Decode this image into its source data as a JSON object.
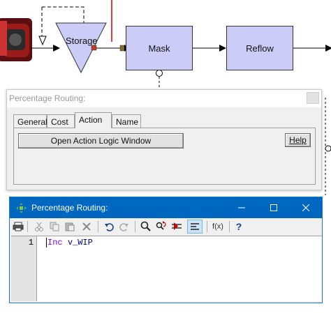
{
  "diagram": {
    "storage_label": "Storage",
    "mask_label": "Mask",
    "reflow_label": "Reflow",
    "colors": {
      "node_fill": "#ccccf8",
      "accent_red": "#d00000"
    }
  },
  "routing_dialog": {
    "title": "Percentage Routing:",
    "tabs": [
      {
        "label": "General"
      },
      {
        "label": "Cost"
      },
      {
        "label": "Action"
      },
      {
        "label": "Name"
      }
    ],
    "active_tab": "Action",
    "open_logic_button": "Open Action Logic Window",
    "help_button": "Help"
  },
  "logic_window": {
    "title": "Percentage Routing:",
    "title_bar_color": "#0067c0",
    "window_buttons": [
      "minimize",
      "maximize",
      "close"
    ],
    "toolbar_icons": [
      "print-icon",
      "cut-icon",
      "copy-icon",
      "paste-icon",
      "delete-icon",
      "undo-icon",
      "redo-icon",
      "find-icon",
      "find-replace-icon",
      "bookmark-icon",
      "format-icon",
      "function-icon",
      "help-icon"
    ],
    "function_label": "f(x)",
    "help_label": "?",
    "line_number": "1",
    "code_keyword": "Inc",
    "code_variable": "v_WIP"
  }
}
